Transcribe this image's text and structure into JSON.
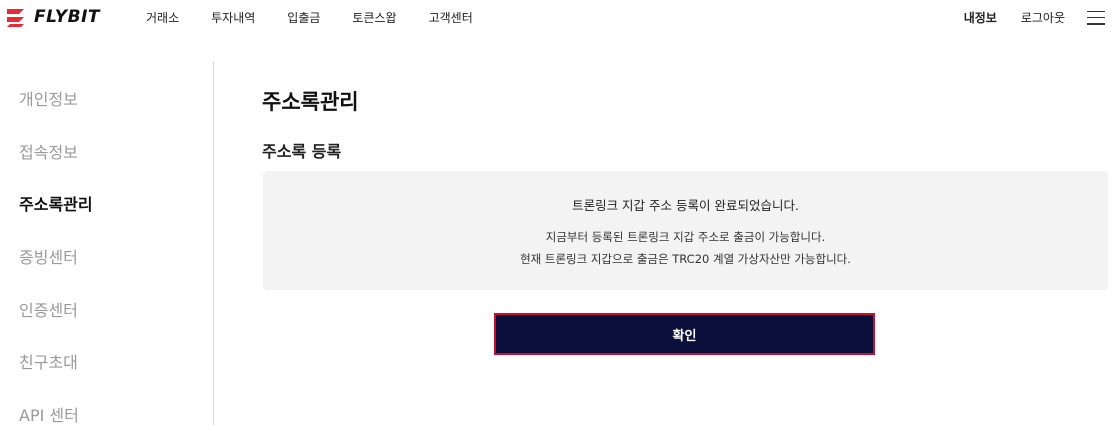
{
  "brand": {
    "name": "FLYBIT",
    "logo_icon": "flybit-logo-icon",
    "accent_color": "#e8293a"
  },
  "header": {
    "nav": [
      "거래소",
      "투자내역",
      "입출금",
      "토큰스왑",
      "고객센터"
    ],
    "my_info": "내정보",
    "logout": "로그아웃",
    "menu_icon": "hamburger-menu-icon"
  },
  "sidebar": {
    "items": [
      "개인정보",
      "접속정보",
      "주소록관리",
      "증빙센터",
      "인증센터",
      "친구초대",
      "API 센터"
    ],
    "active": "주소록관리"
  },
  "main": {
    "title": "주소록관리",
    "section_title": "주소록 등록",
    "message_main": "트론링크 지갑 주소 등록이 완료되었습니다.",
    "message_line1": "지금부터 등록된 트론링크 지갑 주소로 출금이 가능합니다.",
    "message_line2": "현재 트론링크 지갑으로 출금은 TRC20 계열 가상자산만 가능합니다.",
    "confirm_label": "확인"
  },
  "colors": {
    "button_bg": "#0b0f3b",
    "button_border": "#c8102e",
    "box_bg": "#f3f3f3"
  }
}
